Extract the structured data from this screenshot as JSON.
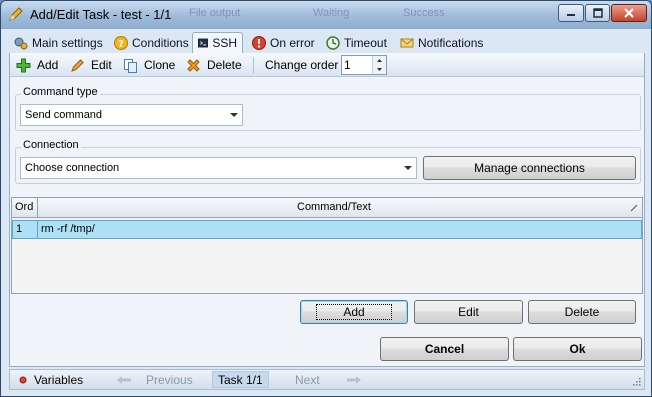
{
  "window": {
    "title": "Add/Edit Task - test - 1/1",
    "background_labels": [
      "File output",
      "Waiting",
      "Success"
    ]
  },
  "tabs": [
    {
      "label": "Main settings",
      "icon": "gears-icon",
      "active": false
    },
    {
      "label": "Conditions",
      "icon": "question-icon",
      "active": false
    },
    {
      "label": "SSH",
      "icon": "terminal-icon",
      "active": true
    },
    {
      "label": "On error",
      "icon": "error-icon",
      "active": false
    },
    {
      "label": "Timeout",
      "icon": "clock-icon",
      "active": false
    },
    {
      "label": "Notifications",
      "icon": "envelope-icon",
      "active": false
    }
  ],
  "toolbar": {
    "add": "Add",
    "edit": "Edit",
    "clone": "Clone",
    "delete": "Delete",
    "change_order": "Change order",
    "order_value": "1"
  },
  "command_type": {
    "label": "Command type",
    "value": "Send command"
  },
  "connection": {
    "label": "Connection",
    "value": "Choose connection",
    "manage_button": "Manage connections"
  },
  "grid": {
    "columns": [
      "Ord",
      "Command/Text"
    ],
    "rows": [
      {
        "ord": "1",
        "command": "rm -rf /tmp/"
      }
    ]
  },
  "grid_buttons": {
    "add": "Add",
    "edit": "Edit",
    "delete": "Delete"
  },
  "dialog_buttons": {
    "cancel": "Cancel",
    "ok": "Ok"
  },
  "statusbar": {
    "variables": "Variables",
    "previous": "Previous",
    "task": "Task 1/1",
    "next": "Next"
  },
  "colors": {
    "selected_row": "#aee0f5",
    "title_gradient": "#9fbbd9"
  }
}
